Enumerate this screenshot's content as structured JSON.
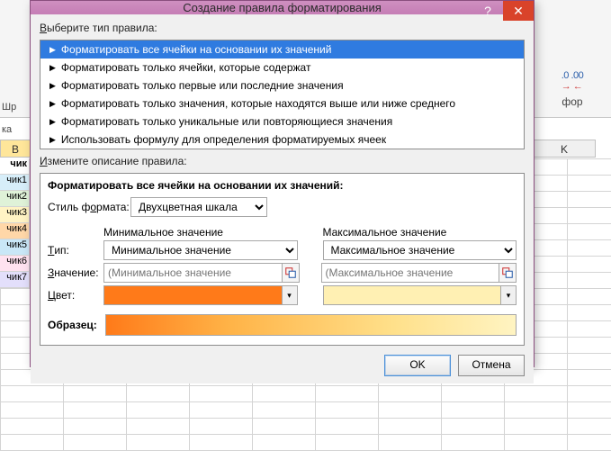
{
  "dialog": {
    "title": "Создание правила форматирования",
    "select_label": "Выберите тип правила:",
    "rules": [
      "Форматировать все ячейки на основании их значений",
      "Форматировать только ячейки, которые содержат",
      "Форматировать только первые или последние значения",
      "Форматировать только значения, которые находятся выше или ниже среднего",
      "Форматировать только уникальные или повторяющиеся значения",
      "Использовать формулу для определения форматируемых ячеек"
    ],
    "edit_label": "Измените описание правила:",
    "desc_title": "Форматировать все ячейки на основании их значений:",
    "format_style_label": "Стиль формата:",
    "format_style_value": "Двухцветная шкала",
    "min_header": "Минимальное значение",
    "max_header": "Максимальное значение",
    "type_label": "Тип:",
    "type_min": "Минимальное значение",
    "type_max": "Максимальное значение",
    "value_label": "Значение:",
    "value_min_placeholder": "(Минимальное значение",
    "value_max_placeholder": "(Максимальное значение",
    "color_label": "Цвет:",
    "color_min": "#ff7a19",
    "color_max": "#fff0b3",
    "sample_label": "Образец:",
    "ok": "OK",
    "cancel": "Отмена"
  },
  "sheet": {
    "col_b_header": "B",
    "col_k_header": "K",
    "header_cell": "чик",
    "rows": [
      "чик1",
      "чик2",
      "чик3",
      "чик4",
      "чик5",
      "чик6",
      "чик7"
    ],
    "ribbon_label": "фор",
    "ribbon_decimals": "⁺⁰₀   ⁻⁰₀",
    "row_bg": [
      "#d7eef9",
      "#dff2d8",
      "#fff3c4",
      "#ffd7a8",
      "#c9e7f7",
      "#ffe2f0",
      "#e3dffb"
    ],
    "side_label": "Шр",
    "ka_label": "ка"
  }
}
